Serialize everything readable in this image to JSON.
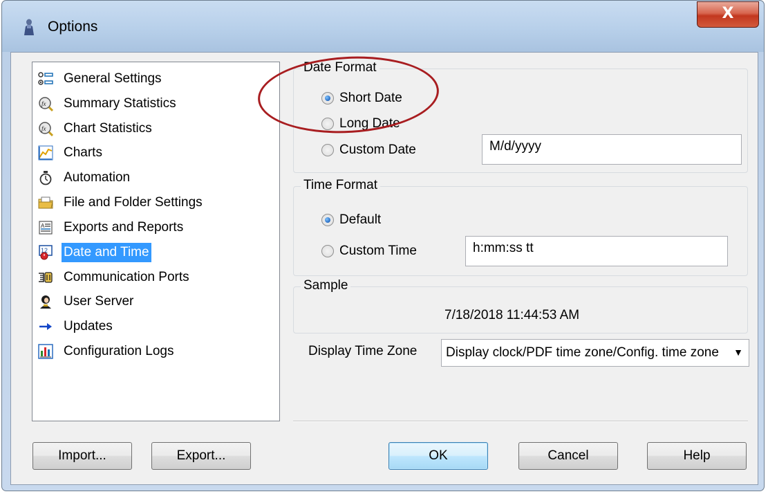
{
  "window": {
    "title": "Options",
    "close_label": "X"
  },
  "nav": {
    "items": [
      {
        "label": "General Settings",
        "icon": "settings-list-icon"
      },
      {
        "label": "Summary Statistics",
        "icon": "fx-magnifier-icon"
      },
      {
        "label": "Chart Statistics",
        "icon": "fx-magnifier-icon"
      },
      {
        "label": "Charts",
        "icon": "line-chart-icon"
      },
      {
        "label": "Automation",
        "icon": "stopwatch-icon"
      },
      {
        "label": "File and Folder Settings",
        "icon": "folder-icon"
      },
      {
        "label": "Exports and Reports",
        "icon": "document-icon"
      },
      {
        "label": "Date and Time",
        "icon": "calendar-clock-icon"
      },
      {
        "label": "Communication Ports",
        "icon": "ports-icon"
      },
      {
        "label": "User Server",
        "icon": "user-icon"
      },
      {
        "label": "Updates",
        "icon": "arrow-right-icon"
      },
      {
        "label": "Configuration Logs",
        "icon": "log-chart-icon"
      }
    ],
    "selected": "Date and Time"
  },
  "date_format": {
    "title": "Date Format",
    "short_label": "Short Date",
    "long_label": "Long Date",
    "custom_label": "Custom Date",
    "custom_value": "M/d/yyyy",
    "selected": "Short Date"
  },
  "time_format": {
    "title": "Time Format",
    "default_label": "Default",
    "custom_label": "Custom Time",
    "custom_value": "h:mm:ss tt",
    "selected": "Default"
  },
  "sample": {
    "title": "Sample",
    "value": "7/18/2018 11:44:53 AM"
  },
  "timezone": {
    "label": "Display Time Zone",
    "value": "Display clock/PDF time zone/Config. time zone"
  },
  "buttons": {
    "import": "Import...",
    "export": "Export...",
    "ok": "OK",
    "cancel": "Cancel",
    "help": "Help"
  },
  "colors": {
    "selection": "#3399ff",
    "annotation": "#a81d20",
    "close_button": "#c2371f"
  }
}
